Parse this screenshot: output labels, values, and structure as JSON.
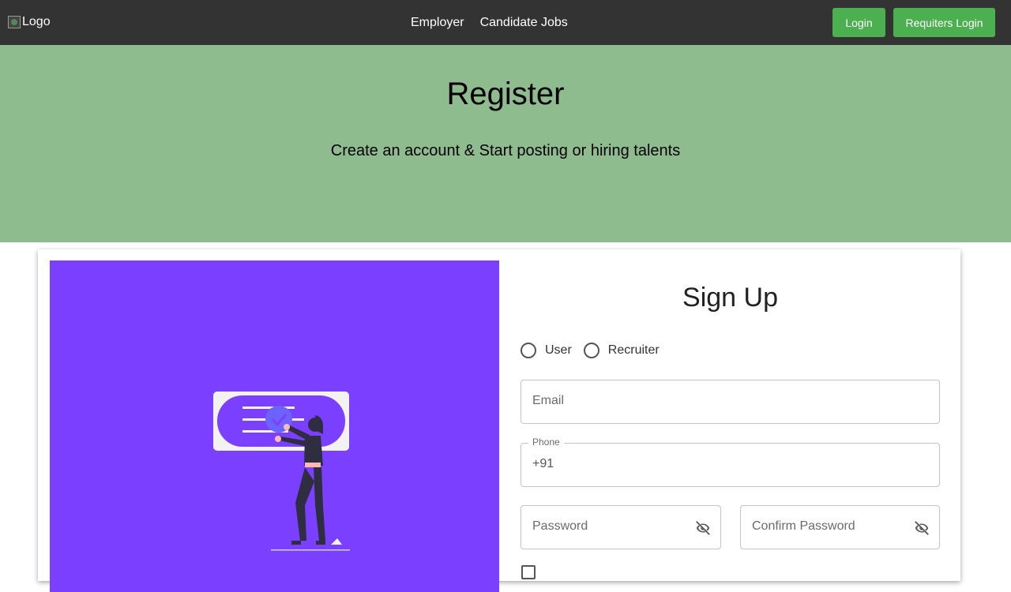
{
  "navbar": {
    "logo_alt": "Logo",
    "links": [
      "Employer",
      "Candidate Jobs"
    ],
    "login_label": "Login",
    "recruiter_login_label": "Requiters Login"
  },
  "hero": {
    "title": "Register",
    "subtitle": "Create an account & Start posting or hiring talents"
  },
  "form": {
    "title": "Sign Up",
    "roles": [
      "User",
      "Recruiter"
    ],
    "email_placeholder": "Email",
    "phone_label": "Phone",
    "phone_value": "+91",
    "password_placeholder": "Password",
    "confirm_password_placeholder": "Confirm Password"
  },
  "colors": {
    "navbar": "#333333",
    "button_green": "#4caf50",
    "hero_bg": "#8fbc8f",
    "illustration_bg": "#7b3fff"
  },
  "icons": [
    "broken-image-icon",
    "eye-off-icon"
  ]
}
